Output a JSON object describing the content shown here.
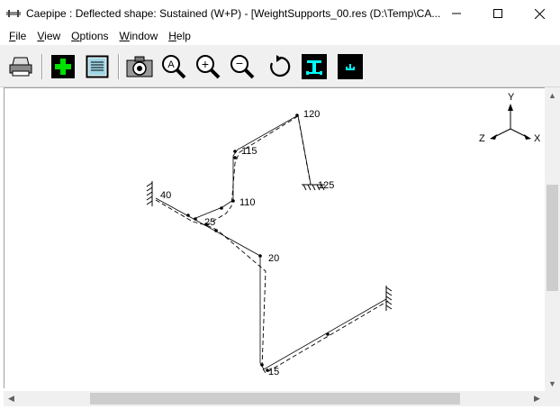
{
  "window": {
    "title": "Caepipe : Deflected shape: Sustained (W+P) -  [WeightSupports_00.res (D:\\Temp\\CA..."
  },
  "menu": [
    {
      "label": "File",
      "key": "F",
      "rest": "ile"
    },
    {
      "label": "View",
      "key": "V",
      "rest": "iew"
    },
    {
      "label": "Options",
      "key": "O",
      "rest": "ptions"
    },
    {
      "label": "Window",
      "key": "W",
      "rest": "indow"
    },
    {
      "label": "Help",
      "key": "H",
      "rest": "elp"
    }
  ],
  "toolbar": {
    "zoom_auto_glyph": "A",
    "zoom_in_glyph": "+",
    "zoom_out_glyph": "−"
  },
  "axes": {
    "y_label": "Y",
    "z_label": "Z",
    "x_label": "X"
  },
  "nodes": {
    "n120": "120",
    "n115": "115",
    "n125": "125",
    "n40": "40",
    "n110": "110",
    "n25": "25",
    "n20": "20",
    "n15": "15"
  },
  "colors": {
    "accent_teal": "#00ffff",
    "toolbar_bg": "#f0f0f0"
  }
}
